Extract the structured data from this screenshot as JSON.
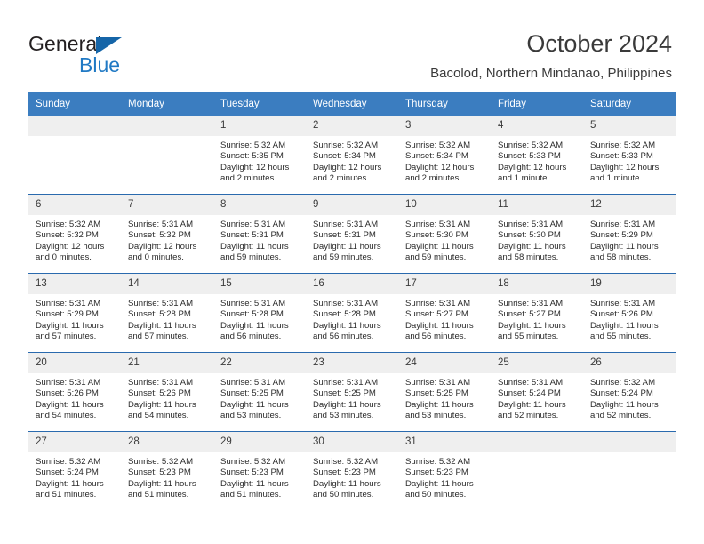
{
  "brand": {
    "name_part1": "General",
    "name_part2": "Blue",
    "accent_color": "#2079c4",
    "triangle_color": "#1565a8"
  },
  "header": {
    "title": "October 2024",
    "subtitle": "Bacolod, Northern Mindanao, Philippines"
  },
  "theme": {
    "header_row_color": "#3b7dc0",
    "row_divider_color": "#2a6aae",
    "day_number_band_color": "#efefef"
  },
  "weekday_headers": [
    "Sunday",
    "Monday",
    "Tuesday",
    "Wednesday",
    "Thursday",
    "Friday",
    "Saturday"
  ],
  "weeks": [
    [
      {
        "day": "",
        "sunrise": "",
        "sunset": "",
        "daylight1": "",
        "daylight2": "",
        "empty": true
      },
      {
        "day": "",
        "sunrise": "",
        "sunset": "",
        "daylight1": "",
        "daylight2": "",
        "empty": true
      },
      {
        "day": "1",
        "sunrise": "Sunrise: 5:32 AM",
        "sunset": "Sunset: 5:35 PM",
        "daylight1": "Daylight: 12 hours",
        "daylight2": "and 2 minutes."
      },
      {
        "day": "2",
        "sunrise": "Sunrise: 5:32 AM",
        "sunset": "Sunset: 5:34 PM",
        "daylight1": "Daylight: 12 hours",
        "daylight2": "and 2 minutes."
      },
      {
        "day": "3",
        "sunrise": "Sunrise: 5:32 AM",
        "sunset": "Sunset: 5:34 PM",
        "daylight1": "Daylight: 12 hours",
        "daylight2": "and 2 minutes."
      },
      {
        "day": "4",
        "sunrise": "Sunrise: 5:32 AM",
        "sunset": "Sunset: 5:33 PM",
        "daylight1": "Daylight: 12 hours",
        "daylight2": "and 1 minute."
      },
      {
        "day": "5",
        "sunrise": "Sunrise: 5:32 AM",
        "sunset": "Sunset: 5:33 PM",
        "daylight1": "Daylight: 12 hours",
        "daylight2": "and 1 minute."
      }
    ],
    [
      {
        "day": "6",
        "sunrise": "Sunrise: 5:32 AM",
        "sunset": "Sunset: 5:32 PM",
        "daylight1": "Daylight: 12 hours",
        "daylight2": "and 0 minutes."
      },
      {
        "day": "7",
        "sunrise": "Sunrise: 5:31 AM",
        "sunset": "Sunset: 5:32 PM",
        "daylight1": "Daylight: 12 hours",
        "daylight2": "and 0 minutes."
      },
      {
        "day": "8",
        "sunrise": "Sunrise: 5:31 AM",
        "sunset": "Sunset: 5:31 PM",
        "daylight1": "Daylight: 11 hours",
        "daylight2": "and 59 minutes."
      },
      {
        "day": "9",
        "sunrise": "Sunrise: 5:31 AM",
        "sunset": "Sunset: 5:31 PM",
        "daylight1": "Daylight: 11 hours",
        "daylight2": "and 59 minutes."
      },
      {
        "day": "10",
        "sunrise": "Sunrise: 5:31 AM",
        "sunset": "Sunset: 5:30 PM",
        "daylight1": "Daylight: 11 hours",
        "daylight2": "and 59 minutes."
      },
      {
        "day": "11",
        "sunrise": "Sunrise: 5:31 AM",
        "sunset": "Sunset: 5:30 PM",
        "daylight1": "Daylight: 11 hours",
        "daylight2": "and 58 minutes."
      },
      {
        "day": "12",
        "sunrise": "Sunrise: 5:31 AM",
        "sunset": "Sunset: 5:29 PM",
        "daylight1": "Daylight: 11 hours",
        "daylight2": "and 58 minutes."
      }
    ],
    [
      {
        "day": "13",
        "sunrise": "Sunrise: 5:31 AM",
        "sunset": "Sunset: 5:29 PM",
        "daylight1": "Daylight: 11 hours",
        "daylight2": "and 57 minutes."
      },
      {
        "day": "14",
        "sunrise": "Sunrise: 5:31 AM",
        "sunset": "Sunset: 5:28 PM",
        "daylight1": "Daylight: 11 hours",
        "daylight2": "and 57 minutes."
      },
      {
        "day": "15",
        "sunrise": "Sunrise: 5:31 AM",
        "sunset": "Sunset: 5:28 PM",
        "daylight1": "Daylight: 11 hours",
        "daylight2": "and 56 minutes."
      },
      {
        "day": "16",
        "sunrise": "Sunrise: 5:31 AM",
        "sunset": "Sunset: 5:28 PM",
        "daylight1": "Daylight: 11 hours",
        "daylight2": "and 56 minutes."
      },
      {
        "day": "17",
        "sunrise": "Sunrise: 5:31 AM",
        "sunset": "Sunset: 5:27 PM",
        "daylight1": "Daylight: 11 hours",
        "daylight2": "and 56 minutes."
      },
      {
        "day": "18",
        "sunrise": "Sunrise: 5:31 AM",
        "sunset": "Sunset: 5:27 PM",
        "daylight1": "Daylight: 11 hours",
        "daylight2": "and 55 minutes."
      },
      {
        "day": "19",
        "sunrise": "Sunrise: 5:31 AM",
        "sunset": "Sunset: 5:26 PM",
        "daylight1": "Daylight: 11 hours",
        "daylight2": "and 55 minutes."
      }
    ],
    [
      {
        "day": "20",
        "sunrise": "Sunrise: 5:31 AM",
        "sunset": "Sunset: 5:26 PM",
        "daylight1": "Daylight: 11 hours",
        "daylight2": "and 54 minutes."
      },
      {
        "day": "21",
        "sunrise": "Sunrise: 5:31 AM",
        "sunset": "Sunset: 5:26 PM",
        "daylight1": "Daylight: 11 hours",
        "daylight2": "and 54 minutes."
      },
      {
        "day": "22",
        "sunrise": "Sunrise: 5:31 AM",
        "sunset": "Sunset: 5:25 PM",
        "daylight1": "Daylight: 11 hours",
        "daylight2": "and 53 minutes."
      },
      {
        "day": "23",
        "sunrise": "Sunrise: 5:31 AM",
        "sunset": "Sunset: 5:25 PM",
        "daylight1": "Daylight: 11 hours",
        "daylight2": "and 53 minutes."
      },
      {
        "day": "24",
        "sunrise": "Sunrise: 5:31 AM",
        "sunset": "Sunset: 5:25 PM",
        "daylight1": "Daylight: 11 hours",
        "daylight2": "and 53 minutes."
      },
      {
        "day": "25",
        "sunrise": "Sunrise: 5:31 AM",
        "sunset": "Sunset: 5:24 PM",
        "daylight1": "Daylight: 11 hours",
        "daylight2": "and 52 minutes."
      },
      {
        "day": "26",
        "sunrise": "Sunrise: 5:32 AM",
        "sunset": "Sunset: 5:24 PM",
        "daylight1": "Daylight: 11 hours",
        "daylight2": "and 52 minutes."
      }
    ],
    [
      {
        "day": "27",
        "sunrise": "Sunrise: 5:32 AM",
        "sunset": "Sunset: 5:24 PM",
        "daylight1": "Daylight: 11 hours",
        "daylight2": "and 51 minutes."
      },
      {
        "day": "28",
        "sunrise": "Sunrise: 5:32 AM",
        "sunset": "Sunset: 5:23 PM",
        "daylight1": "Daylight: 11 hours",
        "daylight2": "and 51 minutes."
      },
      {
        "day": "29",
        "sunrise": "Sunrise: 5:32 AM",
        "sunset": "Sunset: 5:23 PM",
        "daylight1": "Daylight: 11 hours",
        "daylight2": "and 51 minutes."
      },
      {
        "day": "30",
        "sunrise": "Sunrise: 5:32 AM",
        "sunset": "Sunset: 5:23 PM",
        "daylight1": "Daylight: 11 hours",
        "daylight2": "and 50 minutes."
      },
      {
        "day": "31",
        "sunrise": "Sunrise: 5:32 AM",
        "sunset": "Sunset: 5:23 PM",
        "daylight1": "Daylight: 11 hours",
        "daylight2": "and 50 minutes."
      },
      {
        "day": "",
        "sunrise": "",
        "sunset": "",
        "daylight1": "",
        "daylight2": "",
        "empty": true
      },
      {
        "day": "",
        "sunrise": "",
        "sunset": "",
        "daylight1": "",
        "daylight2": "",
        "empty": true
      }
    ]
  ]
}
